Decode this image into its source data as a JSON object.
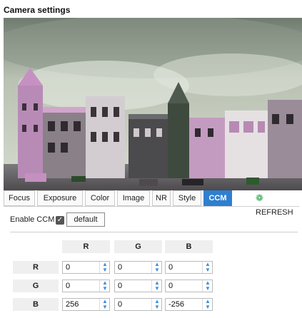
{
  "page": {
    "title": "Camera settings"
  },
  "tabs": [
    {
      "label": "Focus",
      "active": false
    },
    {
      "label": "Exposure",
      "active": false
    },
    {
      "label": "Color",
      "active": false
    },
    {
      "label": "Image",
      "active": false
    },
    {
      "label": "NR",
      "active": false
    },
    {
      "label": "Style",
      "active": false
    },
    {
      "label": "CCM",
      "active": true
    }
  ],
  "refresh": {
    "label": "REFRESH",
    "icon": "gears-icon"
  },
  "ccm": {
    "enable_label": "Enable CCM",
    "enabled": true,
    "checkbox_mark": "✓",
    "default_label": "default",
    "col_headers": [
      "R",
      "G",
      "B"
    ],
    "row_headers": [
      "R",
      "G",
      "B"
    ],
    "matrix": [
      [
        "0",
        "0",
        "0"
      ],
      [
        "0",
        "0",
        "0"
      ],
      [
        "256",
        "0",
        "-256"
      ]
    ]
  },
  "colors": {
    "accent": "#2f7fd0",
    "spinner_arrow": "#3c8fe0",
    "refresh_icon": "#2ea44f"
  }
}
